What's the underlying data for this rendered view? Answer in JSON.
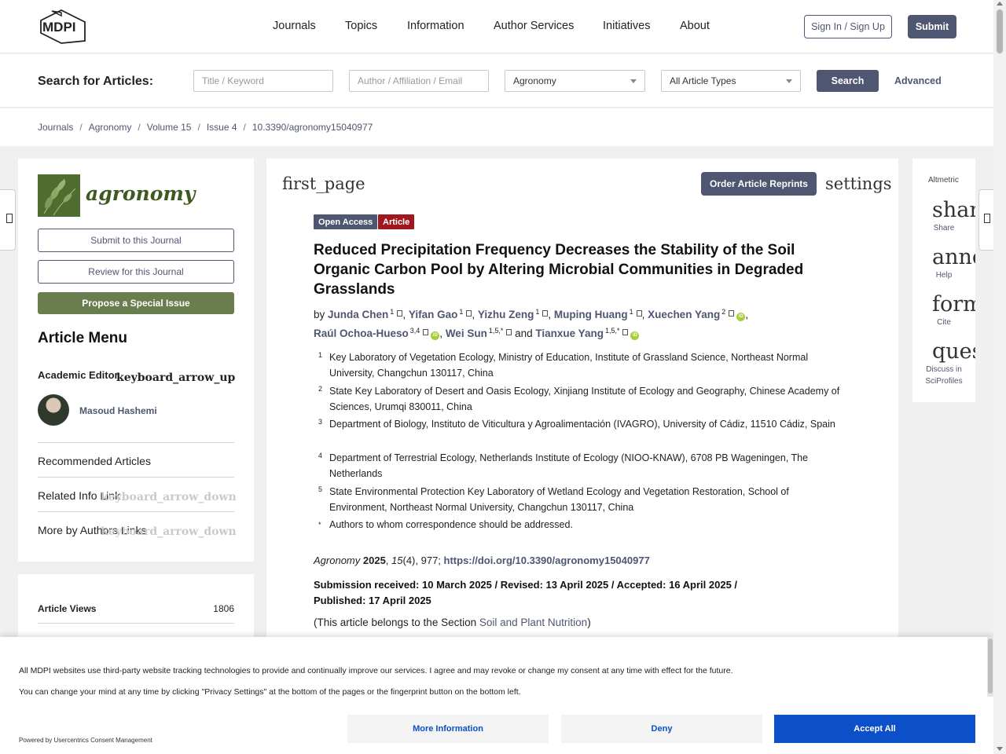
{
  "header": {
    "logo_text": "MDPI",
    "nav": [
      "Journals",
      "Topics",
      "Information",
      "Author Services",
      "Initiatives",
      "About"
    ],
    "signin_label": "Sign In / Sign Up",
    "submit_label": "Submit"
  },
  "search": {
    "title": "Search for Articles:",
    "keyword_placeholder": "Title / Keyword",
    "author_placeholder": "Author / Affiliation / Email",
    "journal_selected": "Agronomy",
    "type_selected": "All Article Types",
    "search_label": "Search",
    "advanced_label": "Advanced"
  },
  "breadcrumb": [
    "Journals",
    "Agronomy",
    "Volume 15",
    "Issue 4",
    "10.3390/agronomy15040977"
  ],
  "sidebar": {
    "journal_name": "agronomy",
    "submit_journal": "Submit to this Journal",
    "review_journal": "Review for this Journal",
    "propose_issue": "Propose a Special Issue",
    "menu_title": "Article Menu",
    "academic_editor_label": "Academic Editor",
    "arrow_up": "keyboard_arrow_up",
    "editor_name": "Masoud Hashemi",
    "recommended": "Recommended Articles",
    "related": "Related Info Link",
    "more_by_authors": "More by Authors Links",
    "arrow_down": "keyboard_arrow_down",
    "views_label": "Article Views",
    "views_value": "1806"
  },
  "article": {
    "first_page": "first_page",
    "reprints_label": "Order Article Reprints",
    "settings": "settings",
    "badge_open": "Open Access",
    "badge_type": "Article",
    "title": "Reduced Precipitation Frequency Decreases the Stability of the Soil Organic Carbon Pool by Altering Microbial Communities in Degraded Grasslands",
    "by": "by",
    "authors": [
      {
        "name": "Junda Chen",
        "sup": "1"
      },
      {
        "name": "Yifan Gao",
        "sup": "1"
      },
      {
        "name": "Yizhu Zeng",
        "sup": "1"
      },
      {
        "name": "Muping Huang",
        "sup": "1"
      },
      {
        "name": "Xuechen Yang",
        "sup": "2"
      },
      {
        "name": "Raúl Ochoa-Hueso",
        "sup": "3,4"
      },
      {
        "name": "Wei Sun",
        "sup": "1,5,*"
      },
      {
        "name": "Tianxue Yang",
        "sup": "1,5,*"
      }
    ],
    "and": "and",
    "affiliations": [
      {
        "num": "1",
        "text": "Key Laboratory of Vegetation Ecology, Ministry of Education, Institute of Grassland Science, Northeast Normal University, Changchun 130117, China"
      },
      {
        "num": "2",
        "text": "State Key Laboratory of Desert and Oasis Ecology, Xinjiang Institute of Ecology and Geography, Chinese Academy of Sciences, Urumqi 830011, China"
      },
      {
        "num": "3",
        "text": "Department of Biology, Instituto de Viticultura y Agroalimentación (IVAGRO), University of Cádiz, 11510 Cádiz, Spain"
      },
      {
        "num": "4",
        "text": "Department of Terrestrial Ecology, Netherlands Institute of Ecology (NIOO-KNAW), 6708 PB Wageningen, The Netherlands"
      },
      {
        "num": "5",
        "text": "State Environmental Protection Key Laboratory of Wetland Ecology and Vegetation Restoration, School of Environment, Northeast Normal University, Changchun 130117, China"
      },
      {
        "num": "*",
        "text": "Authors to whom correspondence should be addressed."
      }
    ],
    "citation_journal": "Agronomy",
    "citation_year": "2025",
    "citation_vol": "15",
    "citation_rest": "(4), 977; ",
    "doi": "https://doi.org/10.3390/agronomy15040977",
    "dates": "Submission received: 10 March 2025 / Revised: 13 April 2025 / Accepted: 16 April 2025 / Published: 17 April 2025",
    "section_prefix": "(This article belongs to the Section ",
    "section_name": "Soil and Plant Nutrition",
    "section_suffix": ")"
  },
  "rightbar": {
    "altmetric": "Altmetric",
    "items": [
      {
        "icon": "share",
        "label": "Share"
      },
      {
        "icon": "announcement",
        "label": "Help"
      },
      {
        "icon": "format_quote",
        "label": "Cite"
      },
      {
        "icon": "question_answer",
        "label": "Discuss in SciProfiles"
      }
    ]
  },
  "consent": {
    "line1": "All MDPI websites use third-party website tracking technologies to provide and continually improve our services. I agree and may revoke or change my consent at any time with effect for the future.",
    "line2": "You can change your mind at any time by clicking \"Privacy Settings\" at the bottom of the pages or the fingerprint button on the bottom left.",
    "powered": "Powered by Usercentrics Consent Management",
    "more_info": "More Information",
    "deny": "Deny",
    "accept": "Accept All"
  },
  "colors": {
    "primary": "#4f5671",
    "open_access": "#4f5671",
    "article_badge": "#a0171e",
    "journal_green": "#6a7d4f",
    "accept": "#0b4fc9",
    "orcid": "#a6ce39"
  }
}
